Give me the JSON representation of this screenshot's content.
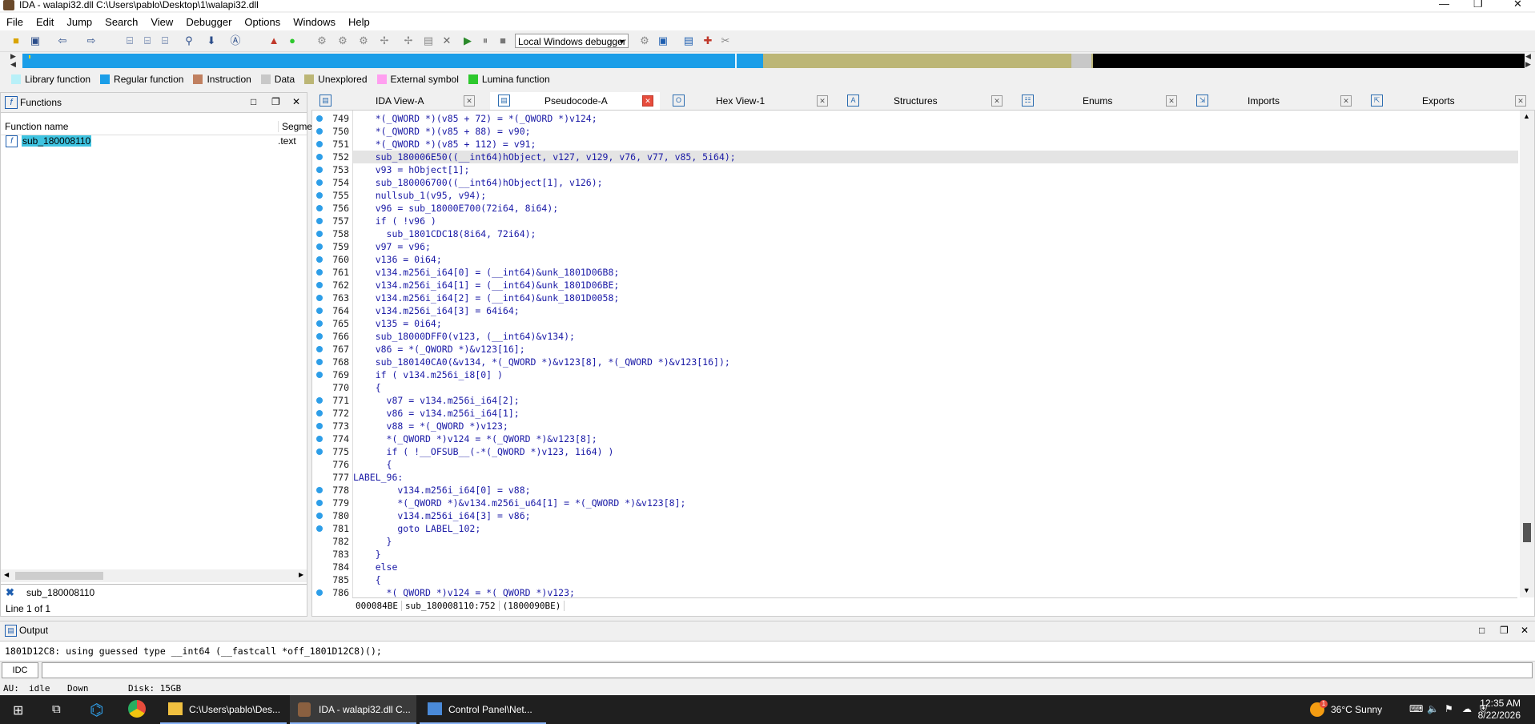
{
  "window": {
    "title": "IDA - walapi32.dll C:\\Users\\pablo\\Desktop\\1\\walapi32.dll",
    "controls": [
      "—",
      "❐",
      "✕"
    ]
  },
  "menu": [
    "File",
    "Edit",
    "Jump",
    "Search",
    "View",
    "Debugger",
    "Options",
    "Windows",
    "Help"
  ],
  "toolbar": {
    "debugger_select": "Local Windows debugger"
  },
  "legend": [
    {
      "label": "Library function",
      "color": "#b8f0f8"
    },
    {
      "label": "Regular function",
      "color": "#1b9ee8"
    },
    {
      "label": "Instruction",
      "color": "#c08060"
    },
    {
      "label": "Data",
      "color": "#c8c8c8"
    },
    {
      "label": "Unexplored",
      "color": "#bcb676"
    },
    {
      "label": "External symbol",
      "color": "#ff9ff0"
    },
    {
      "label": "Lumina function",
      "color": "#2dc82d"
    }
  ],
  "functions_panel": {
    "title": "Functions",
    "col_name": "Function name",
    "col_segment": "Segme",
    "rows": [
      {
        "name": "sub_180008110",
        "segment": ".text"
      }
    ],
    "filter": "sub_180008110",
    "line_count": "Line 1 of 1"
  },
  "tabs": [
    {
      "label": "IDA View-A",
      "active": false
    },
    {
      "label": "Pseudocode-A",
      "active": true
    },
    {
      "label": "Hex View-1",
      "active": false
    },
    {
      "label": "Structures",
      "active": false
    },
    {
      "label": "Enums",
      "active": false
    },
    {
      "label": "Imports",
      "active": false
    },
    {
      "label": "Exports",
      "active": false
    }
  ],
  "code": {
    "lines": [
      {
        "n": "749",
        "dot": true,
        "text": "    *(_QWORD *)(v85 + 72) = *(_QWORD *)v124;"
      },
      {
        "n": "750",
        "dot": true,
        "text": "    *(_QWORD *)(v85 + 88) = v90;"
      },
      {
        "n": "751",
        "dot": true,
        "text": "    *(_QWORD *)(v85 + 112) = v91;"
      },
      {
        "n": "752",
        "dot": true,
        "text": "    sub_180006E50((__int64)hObject, v127, v129, v76, v77, v85, 5i64);",
        "hl": true
      },
      {
        "n": "753",
        "dot": true,
        "text": "    v93 = hObject[1];"
      },
      {
        "n": "754",
        "dot": true,
        "text": "    sub_180006700((__int64)hObject[1], v126);"
      },
      {
        "n": "755",
        "dot": true,
        "text": "    nullsub_1(v95, v94);"
      },
      {
        "n": "756",
        "dot": true,
        "text": "    v96 = sub_18000E700(72i64, 8i64);"
      },
      {
        "n": "757",
        "dot": true,
        "text": "    if ( !v96 )"
      },
      {
        "n": "758",
        "dot": true,
        "text": "      sub_1801CDC18(8i64, 72i64);"
      },
      {
        "n": "759",
        "dot": true,
        "text": "    v97 = v96;"
      },
      {
        "n": "760",
        "dot": true,
        "text": "    v136 = 0i64;"
      },
      {
        "n": "761",
        "dot": true,
        "text": "    v134.m256i_i64[0] = (__int64)&unk_1801D06B8;"
      },
      {
        "n": "762",
        "dot": true,
        "text": "    v134.m256i_i64[1] = (__int64)&unk_1801D06BE;"
      },
      {
        "n": "763",
        "dot": true,
        "text": "    v134.m256i_i64[2] = (__int64)&unk_1801D0058;"
      },
      {
        "n": "764",
        "dot": true,
        "text": "    v134.m256i_i64[3] = 64i64;"
      },
      {
        "n": "765",
        "dot": true,
        "text": "    v135 = 0i64;"
      },
      {
        "n": "766",
        "dot": true,
        "text": "    sub_18000DFF0(v123, (__int64)&v134);"
      },
      {
        "n": "767",
        "dot": true,
        "text": "    v86 = *(_QWORD *)&v123[16];"
      },
      {
        "n": "768",
        "dot": true,
        "text": "    sub_180140CA0(&v134, *(_QWORD *)&v123[8], *(_QWORD *)&v123[16]);"
      },
      {
        "n": "769",
        "dot": true,
        "text": "    if ( v134.m256i_i8[0] )"
      },
      {
        "n": "770",
        "dot": false,
        "text": "    {"
      },
      {
        "n": "771",
        "dot": true,
        "text": "      v87 = v134.m256i_i64[2];"
      },
      {
        "n": "772",
        "dot": true,
        "text": "      v86 = v134.m256i_i64[1];"
      },
      {
        "n": "773",
        "dot": true,
        "text": "      v88 = *(_QWORD *)v123;"
      },
      {
        "n": "774",
        "dot": true,
        "text": "      *(_QWORD *)v124 = *(_QWORD *)&v123[8];"
      },
      {
        "n": "775",
        "dot": true,
        "text": "      if ( !__OFSUB__(-*(_QWORD *)v123, 1i64) )"
      },
      {
        "n": "776",
        "dot": false,
        "text": "      {"
      },
      {
        "n": "777",
        "dot": false,
        "text": "LABEL_96:"
      },
      {
        "n": "778",
        "dot": true,
        "text": "        v134.m256i_i64[0] = v88;"
      },
      {
        "n": "779",
        "dot": true,
        "text": "        *(_QWORD *)&v134.m256i_u64[1] = *(_QWORD *)&v123[8];"
      },
      {
        "n": "780",
        "dot": true,
        "text": "        v134.m256i_i64[3] = v86;"
      },
      {
        "n": "781",
        "dot": true,
        "text": "        goto LABEL_102;"
      },
      {
        "n": "782",
        "dot": false,
        "text": "      }"
      },
      {
        "n": "783",
        "dot": false,
        "text": "    }"
      },
      {
        "n": "784",
        "dot": false,
        "text": "    else"
      },
      {
        "n": "785",
        "dot": false,
        "text": "    {"
      },
      {
        "n": "786",
        "dot": true,
        "text": "      *(_QWORD *)v124 = *(_QWORD *)v123;"
      }
    ],
    "status_addr": "000084BE",
    "status_loc": "sub_180008110:752",
    "status_ea": "(1800090BE)"
  },
  "output": {
    "title": "Output",
    "line": "1801D12C8: using guessed type __int64 (__fastcall *off_1801D12C8)();",
    "idc_label": "IDC"
  },
  "status": {
    "au": "AU:",
    "au_state": "idle",
    "direction": "Down",
    "disk": "Disk: 15GB"
  },
  "taskbar": {
    "items": [
      {
        "label": "C:\\Users\\pablo\\Des...",
        "icon": "folder-icon"
      },
      {
        "label": "IDA - walapi32.dll C...",
        "icon": "ida-icon"
      },
      {
        "label": "Control Panel\\Net...",
        "icon": "control-panel-icon"
      }
    ],
    "weather_badge": "1",
    "weather": "36°C  Sunny",
    "time": "12:35 AM",
    "date": "8/22/2026"
  }
}
